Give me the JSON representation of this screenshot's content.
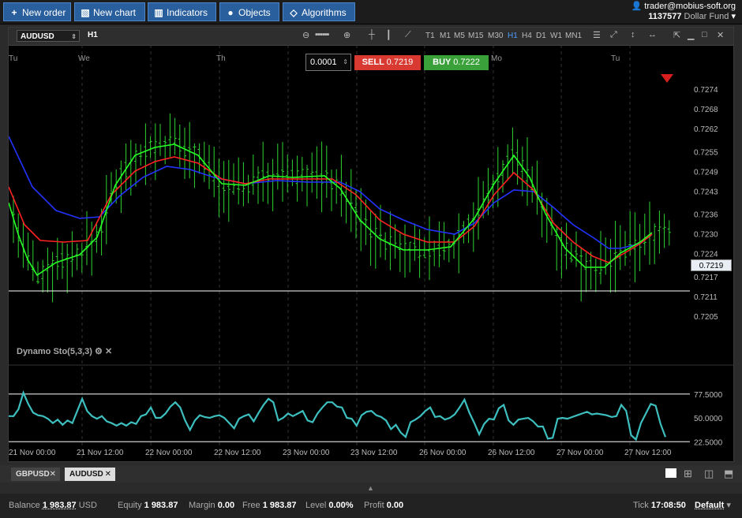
{
  "toolbar": {
    "new_order": "New order",
    "new_chart": "New chart",
    "indicators": "Indicators",
    "objects": "Objects",
    "algorithms": "Algorithms"
  },
  "user": {
    "email": "trader@mobius-soft.org",
    "account": "1137577",
    "fund": "Dollar Fund"
  },
  "chart": {
    "symbol": "AUDUSD",
    "timeframe": "H1",
    "timeframes": [
      "T1",
      "M1",
      "M5",
      "M15",
      "M30",
      "H1",
      "H4",
      "D1",
      "W1",
      "MN1"
    ],
    "active_timeframe": "H1",
    "quantity": "0.0001",
    "sell_label": "SELL",
    "sell_price": "0.7219",
    "buy_label": "BUY",
    "buy_price": "0.7222",
    "day_markers": [
      "Tu",
      "We",
      "Th",
      "Mo",
      "Tu"
    ],
    "price_ticks": [
      "0.7274",
      "0.7268",
      "0.7262",
      "0.7255",
      "0.7249",
      "0.7243",
      "0.7236",
      "0.7230",
      "0.7224",
      "0.7217",
      "0.7211",
      "0.7205"
    ],
    "current_price": "0.7219",
    "indicator_name": "Dynamo Sto(5,3,3)",
    "indicator_levels": [
      "77.5000",
      "50.0000",
      "22.5000"
    ],
    "time_ticks": [
      "21 Nov 00:00",
      "21 Nov 12:00",
      "22 Nov 00:00",
      "22 Nov 12:00",
      "23 Nov 00:00",
      "23 Nov 12:00",
      "26 Nov 00:00",
      "26 Nov 12:00",
      "27 Nov 00:00",
      "27 Nov 12:00"
    ],
    "colors": {
      "candles": "#2fd32f",
      "ma_fast": "#26ff26",
      "ma_mid": "#ff2222",
      "ma_slow": "#2233ff",
      "stoch": "#3dbfbf"
    }
  },
  "chart_data": {
    "type": "line",
    "ylim": [
      0.72,
      0.728
    ],
    "series": [],
    "stoch": {
      "values": [
        52,
        52,
        60,
        79,
        66,
        56,
        53,
        52,
        49,
        44,
        48,
        42,
        47,
        44,
        58,
        72,
        58,
        52,
        49,
        52,
        46,
        44,
        41,
        44,
        41,
        45,
        43,
        52,
        54,
        62,
        50,
        50,
        55,
        63,
        68,
        62,
        47,
        36,
        47,
        53,
        51,
        50,
        52,
        53,
        50,
        44,
        38,
        49,
        52,
        54,
        46,
        56,
        65,
        72,
        68,
        47,
        50,
        55,
        52,
        55,
        58,
        47,
        45,
        55,
        62,
        68,
        68,
        63,
        62,
        50,
        49,
        41,
        53,
        57,
        58,
        53,
        51,
        47,
        37,
        42,
        33,
        28,
        45,
        48,
        52,
        58,
        62,
        51,
        52,
        48,
        50,
        54,
        62,
        71,
        56,
        44,
        31,
        43,
        49,
        48,
        61,
        65,
        47,
        42,
        48,
        49,
        50,
        46,
        40,
        40,
        26,
        27,
        49,
        50,
        49,
        51,
        53,
        55,
        57,
        54,
        55,
        54,
        53,
        51,
        52,
        65,
        58,
        30,
        25,
        44,
        55,
        66,
        64,
        43,
        28
      ],
      "ylim": [
        0,
        100
      ]
    }
  },
  "tabs": [
    {
      "label": "GBPUSD"
    },
    {
      "label": "AUDUSD"
    }
  ],
  "status": {
    "balance_label": "Balance",
    "balance": "1 983.87",
    "currency": "USD",
    "equity_label": "Equity",
    "equity": "1 983.87",
    "margin_label": "Margin",
    "margin": "0.00",
    "free_label": "Free",
    "free": "1 983.87",
    "level_label": "Level",
    "level": "0.00%",
    "profit_label": "Profit",
    "profit": "0.00",
    "tick_label": "Tick",
    "tick": "17:08:50",
    "default_label": "Default"
  }
}
